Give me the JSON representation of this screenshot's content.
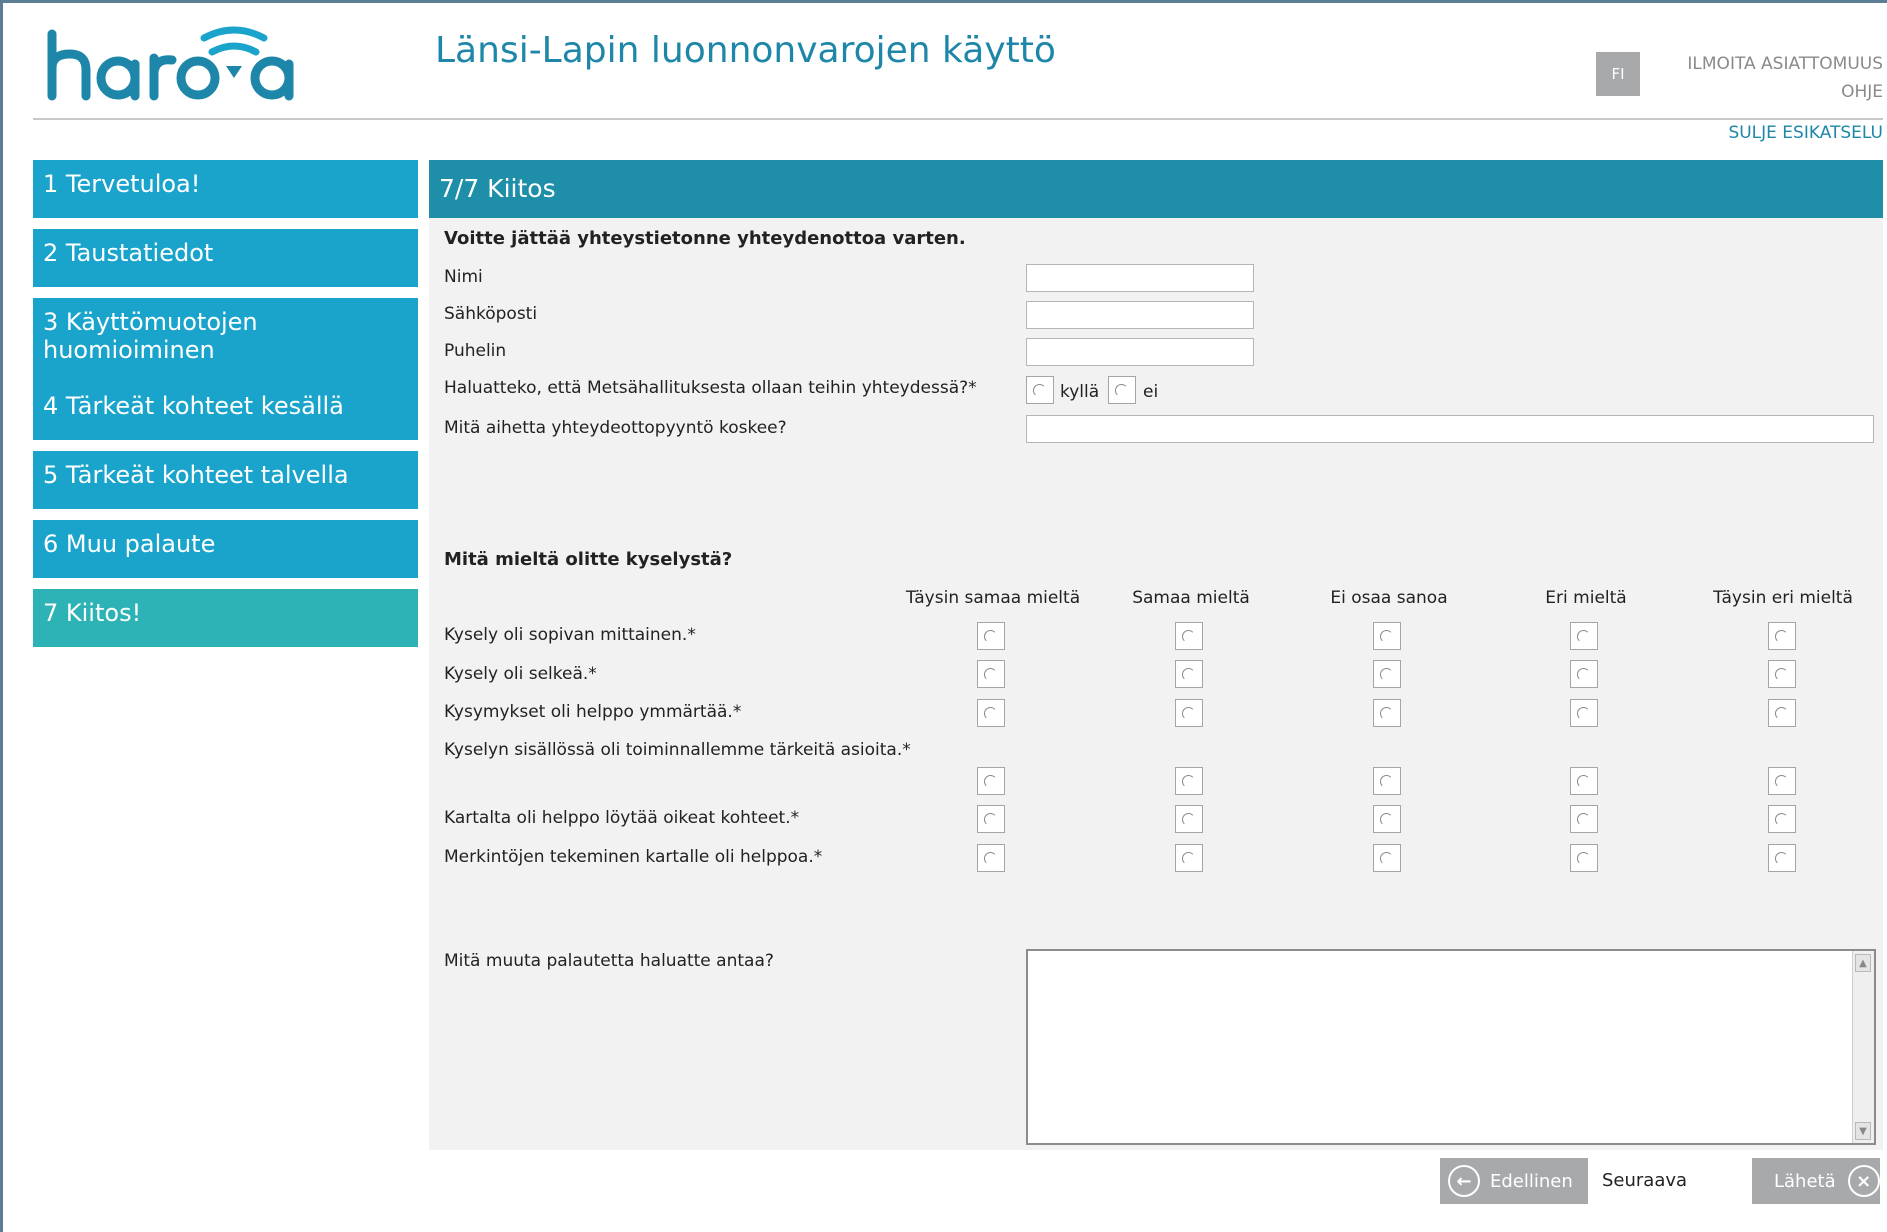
{
  "header": {
    "site_title": "Länsi-Lapin luonnonvarojen käyttö",
    "lang": "FI",
    "report_issue": "ILMOITA ASIATTOMUUS",
    "help": "OHJE",
    "close_preview": "SULJE ESIKATSELU"
  },
  "sidebar": {
    "items": [
      {
        "label": "1 Tervetuloa!"
      },
      {
        "label": "2 Taustatiedot"
      },
      {
        "label": "3 Käyttömuotojen huomioiminen"
      },
      {
        "label": "4 Tärkeät kohteet kesällä"
      },
      {
        "label": "5 Tärkeät kohteet talvella"
      },
      {
        "label": "6 Muu palaute"
      },
      {
        "label": "7 Kiitos!"
      }
    ]
  },
  "panel": {
    "title": "7/7 Kiitos",
    "contact_heading": "Voitte jättää yhteystietonne yhteydenottoa varten.",
    "name_label": "Nimi",
    "email_label": "Sähköposti",
    "phone_label": "Puhelin",
    "contact_question": "Haluatteko, että Metsähallituksesta ollaan teihin yhteydessä?*",
    "yes_label": "kyllä",
    "no_label": "ei",
    "topic_question": "Mitä aihetta yhteydeottopyyntö koskee?",
    "survey_heading": "Mitä mieltä olitte kyselystä?",
    "scale": [
      "Täysin samaa mieltä",
      "Samaa mieltä",
      "Ei osaa sanoa",
      "Eri mieltä",
      "Täysin eri mieltä"
    ],
    "statements": [
      "Kysely oli sopivan mittainen.*",
      "Kysely oli selkeä.*",
      "Kysymykset oli helppo ymmärtää.*",
      "Kyselyn sisällössä oli toiminnallemme tärkeitä asioita.*",
      "Kartalta oli helppo löytää oikeat kohteet.*",
      "Merkintöjen tekeminen kartalle oli helppoa.*"
    ],
    "feedback_question": "Mitä muuta palautetta haluatte antaa?"
  },
  "footer": {
    "prev_label": "Edellinen",
    "next_label": "Seuraava",
    "send_label": "Lähetä"
  },
  "colors": {
    "nav_item": "#1aa4cc",
    "nav_active": "#2db2b5",
    "panel_header": "#1f8ea8",
    "title_text": "#1e86a8",
    "button_grey": "#a7a9ab"
  }
}
